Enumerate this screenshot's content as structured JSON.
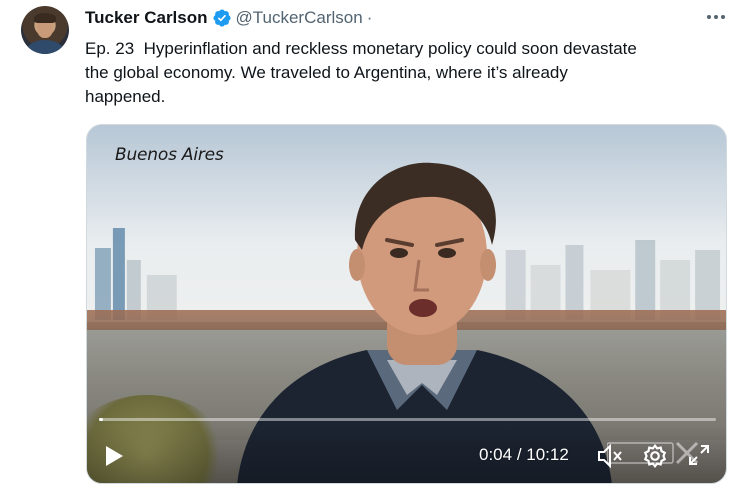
{
  "tweet": {
    "author_name": "Tucker Carlson",
    "handle": "@TuckerCarlson",
    "separator": "·",
    "text": "Ep. 23  Hyperinflation and reckless monetary policy could soon devastate\nthe global economy. We traveled to Argentina, where it’s already\nhappened."
  },
  "icons": {
    "verified": "verified-badge-icon",
    "more": "more-options-icon",
    "play": "play-icon",
    "mute": "mute-icon",
    "settings": "gear-icon",
    "fullscreen": "fullscreen-icon"
  },
  "video": {
    "location_caption": "Buenos Aires",
    "current_time": "0:04",
    "time_separator": " / ",
    "duration": "10:12",
    "progress_fraction": 0.007,
    "watermark_text": "TUCKER ON X"
  },
  "colors": {
    "verified_blue": "#1d9bf0",
    "text_primary": "#0f1419",
    "text_secondary": "#536471"
  }
}
